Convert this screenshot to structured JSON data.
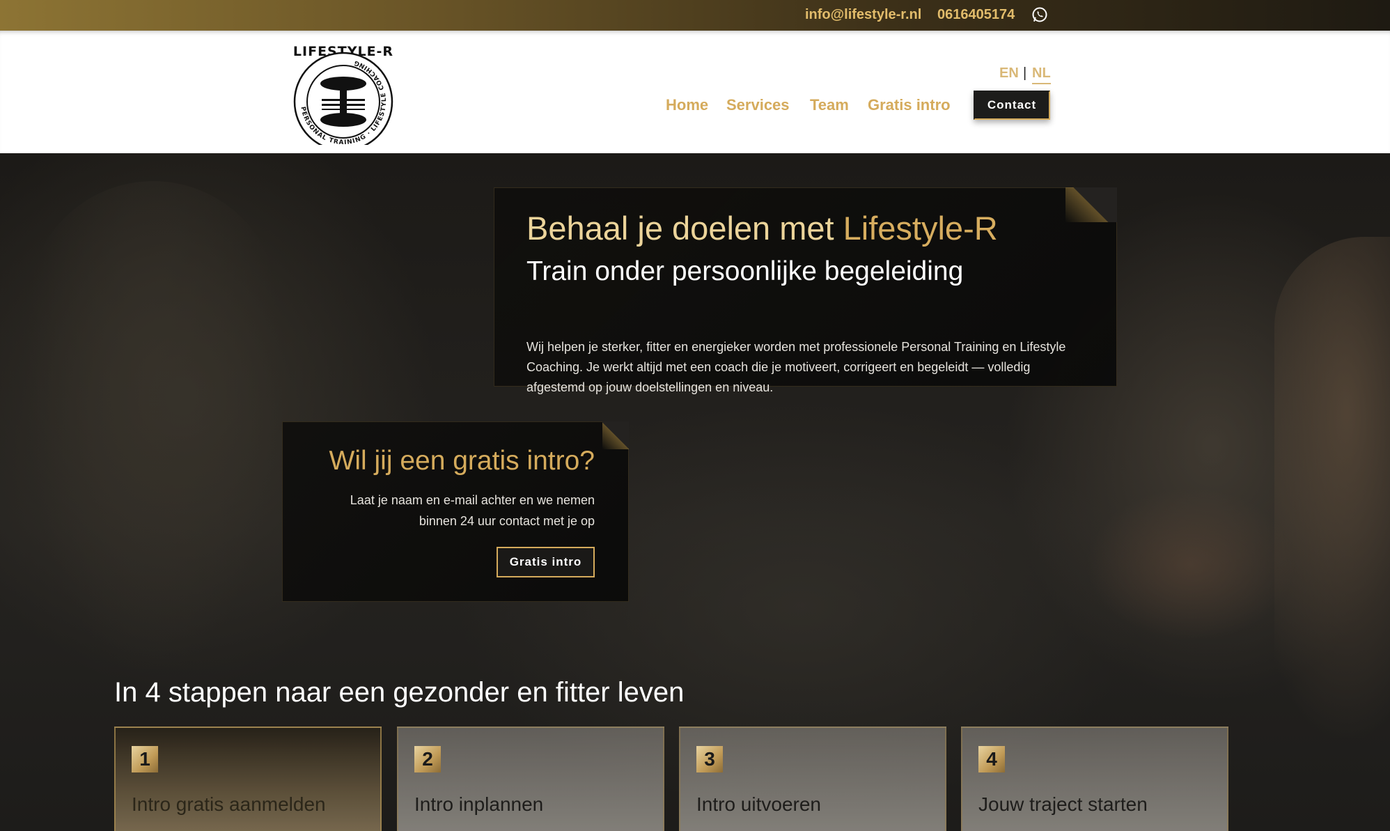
{
  "topbar": {
    "email": "info@lifestyle-r.nl",
    "phone": "0616405174",
    "whatsapp_icon": "whatsapp-icon"
  },
  "header": {
    "logo": {
      "title": "LIFESTYLE-R",
      "ring_text": "PERSONAL TRAINING · LIFESTYLE COACHING"
    },
    "languages": {
      "en": "EN",
      "separator": "|",
      "nl": "NL",
      "active": "NL"
    },
    "nav": {
      "home": "Home",
      "services": "Services",
      "team": "Team",
      "intro": "Gratis intro",
      "contact": "Contact"
    }
  },
  "hero": {
    "title_part1": "Behaal je doelen met ",
    "title_part2": "Lifestyle-R",
    "subtitle": "Train onder persoonlijke begeleiding",
    "description": "Wij helpen je sterker, fitter en energieker worden met professionele Personal Training en Lifestyle Coaching. Je werkt altijd met een coach die je motiveert, corrigeert en begeleidt — volledig afgestemd op jouw doelstellingen en niveau."
  },
  "intro_card": {
    "title": "Wil jij een gratis intro?",
    "text": "Laat je naam en e-mail achter en we nemen binnen 24 uur contact met je op",
    "button": "Gratis intro"
  },
  "steps": {
    "title": "In 4 stappen naar een gezonder en fitter leven",
    "items": [
      {
        "number": "1",
        "label": "Intro gratis aanmelden"
      },
      {
        "number": "2",
        "label": "Intro inplannen"
      },
      {
        "number": "3",
        "label": "Intro uitvoeren"
      },
      {
        "number": "4",
        "label": "Jouw traject starten"
      }
    ]
  },
  "colors": {
    "gold": "#d5ab5c",
    "gold_light": "#ecd49a",
    "dark": "#1d1c1b",
    "white": "#ffffff"
  }
}
